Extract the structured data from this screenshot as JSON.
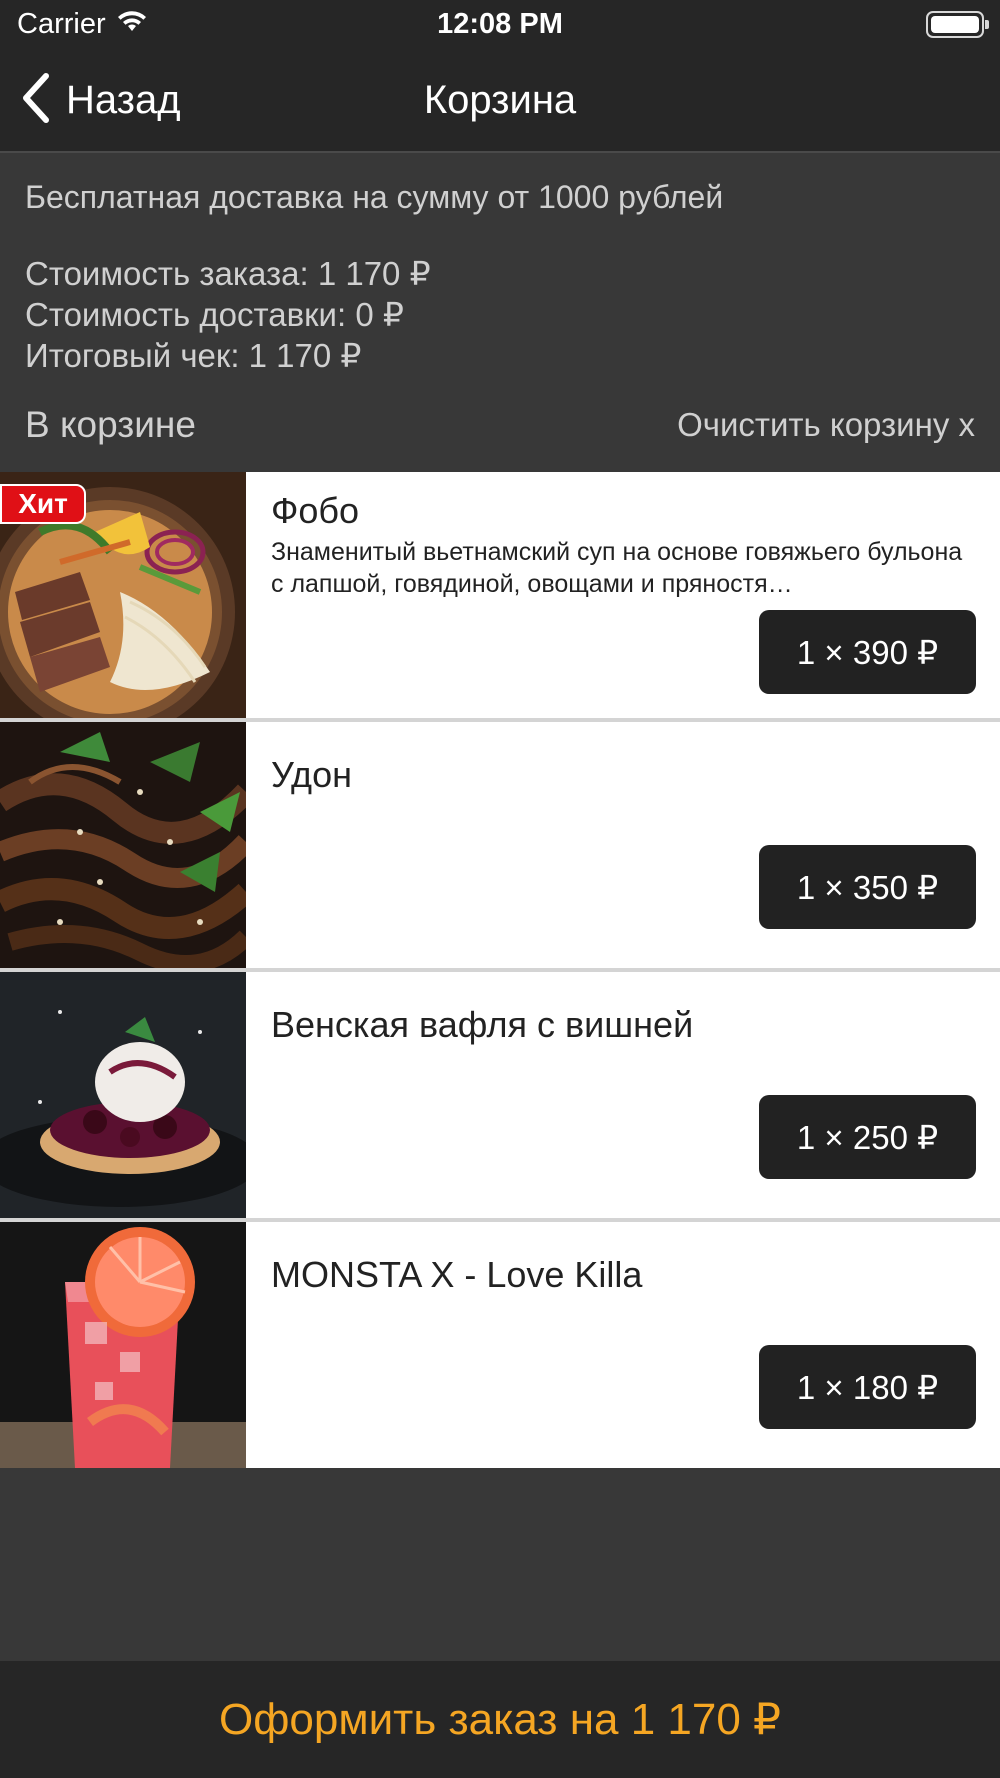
{
  "status_bar": {
    "carrier": "Carrier",
    "time": "12:08 PM",
    "icons": [
      "wifi-icon",
      "battery-icon"
    ]
  },
  "nav": {
    "back_label": "Назад",
    "back_icon": "chevron-left-icon",
    "title": "Корзина"
  },
  "summary": {
    "free_delivery": "Бесплатная доставка на сумму от 1000 рублей",
    "order_cost": "Стоимость заказа: 1 170 ₽",
    "delivery_cost": "Стоимость доставки: 0 ₽",
    "total": "Итоговый чек: 1 170 ₽",
    "in_cart_label": "В корзине",
    "clear_cart_label": "Очистить корзину x"
  },
  "items": [
    {
      "name": "Фобо",
      "description": "Знаменитый вьетнамский суп на основе говяжьего бульона с лапшой, говядиной, овощами и пряностя…",
      "price_label": "1 × 390 ₽",
      "badge": "Хит",
      "image": "pho-soup-photo"
    },
    {
      "name": "Удон",
      "description": "",
      "price_label": "1 × 350 ₽",
      "image": "udon-noodles-photo"
    },
    {
      "name": "Венская вафля с вишней",
      "description": "",
      "price_label": "1 × 250 ₽",
      "image": "waffle-cherry-photo"
    },
    {
      "name": "MONSTA X - Love Killa",
      "description": "",
      "price_label": "1 × 180 ₽",
      "image": "grapefruit-drink-photo"
    }
  ],
  "checkout": {
    "label": "Оформить заказ на 1 170 ₽"
  },
  "colors": {
    "bar_bg": "#262626",
    "body_bg": "#383838",
    "accent": "#f5a623",
    "badge": "#e01016",
    "price_button": "#222222"
  }
}
